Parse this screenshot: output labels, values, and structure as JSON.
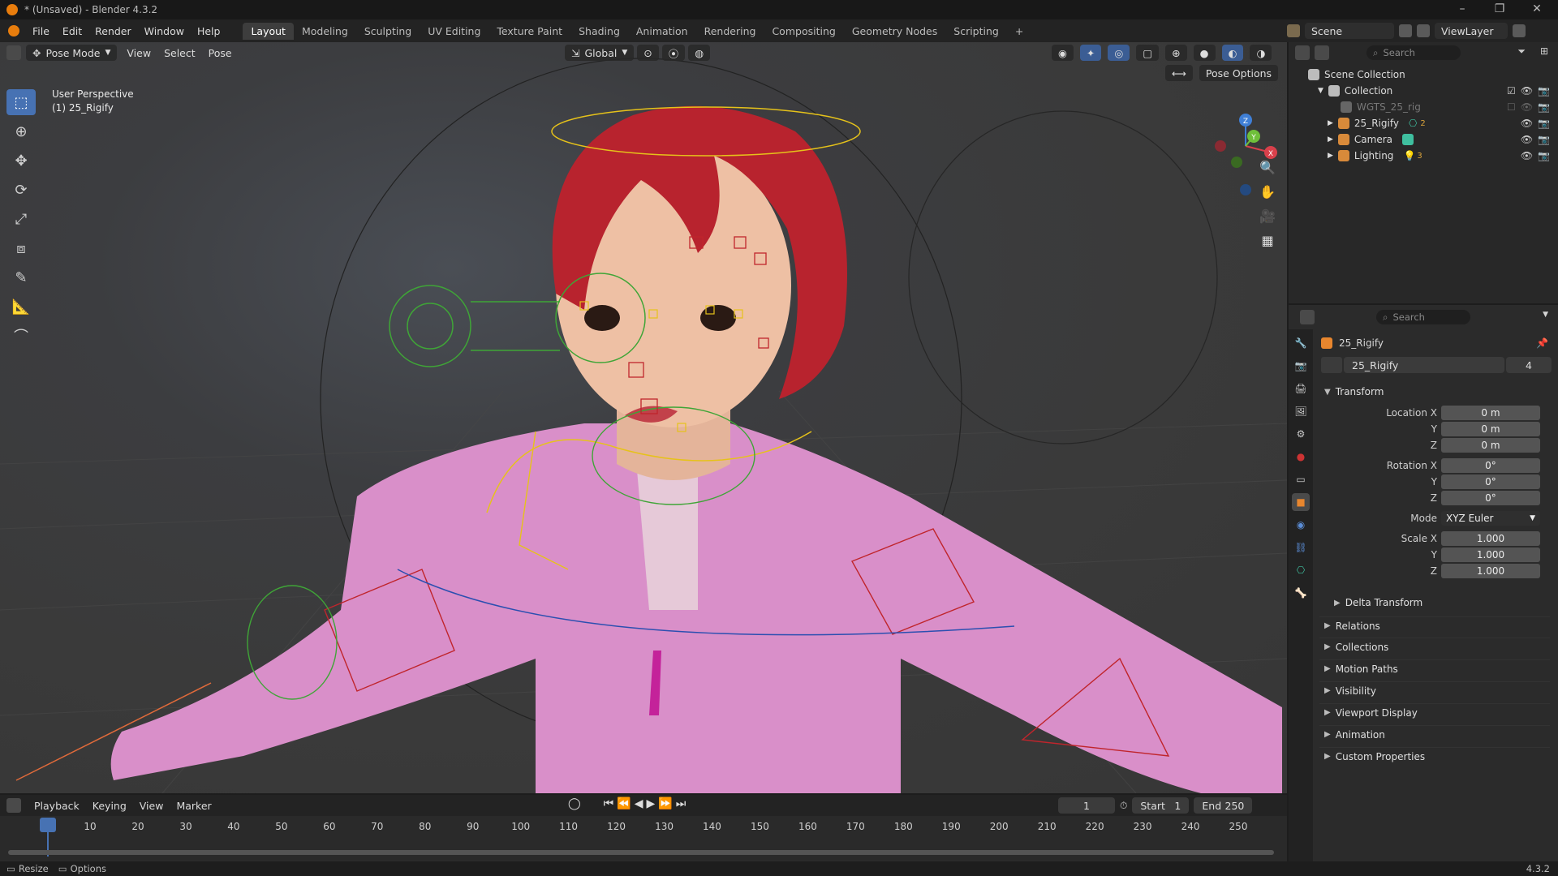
{
  "window": {
    "title": "* (Unsaved) - Blender 4.3.2"
  },
  "menu": [
    "File",
    "Edit",
    "Render",
    "Window",
    "Help"
  ],
  "workspaces": [
    "Layout",
    "Modeling",
    "Sculpting",
    "UV Editing",
    "Texture Paint",
    "Shading",
    "Animation",
    "Rendering",
    "Compositing",
    "Geometry Nodes",
    "Scripting"
  ],
  "active_workspace": "Layout",
  "scene": {
    "name": "Scene",
    "view_layer": "ViewLayer"
  },
  "viewport": {
    "mode": "Pose Mode",
    "menus": [
      "View",
      "Select",
      "Pose"
    ],
    "transform_orientation": "Global",
    "pose_options": "Pose Options",
    "info_line1": "User Perspective",
    "info_line2": "(1) 25_Rigify",
    "gizmo_axes": [
      "X",
      "Y",
      "Z"
    ]
  },
  "outliner": {
    "search_placeholder": "Search",
    "items": [
      {
        "label": "Scene Collection"
      },
      {
        "label": "Collection"
      },
      {
        "label": "WGTS_25_rig"
      },
      {
        "label": "25_Rigify",
        "extra": "2"
      },
      {
        "label": "Camera"
      },
      {
        "label": "Lighting",
        "extra": "3"
      }
    ]
  },
  "properties": {
    "search_placeholder": "Search",
    "object_name": "25_Rigify",
    "data_name": "25_Rigify",
    "users": "4",
    "transform_title": "Transform",
    "location": {
      "label": "Location X",
      "x": "0 m",
      "y": "0 m",
      "z": "0 m"
    },
    "rotation": {
      "label": "Rotation X",
      "x": "0°",
      "y": "0°",
      "z": "0°"
    },
    "mode_label": "Mode",
    "mode_value": "XYZ Euler",
    "scale": {
      "label": "Scale X",
      "x": "1.000",
      "y": "1.000",
      "z": "1.000"
    },
    "axis_y": "Y",
    "axis_z": "Z",
    "delta": "Delta Transform",
    "panels": [
      "Relations",
      "Collections",
      "Motion Paths",
      "Visibility",
      "Viewport Display",
      "Animation",
      "Custom Properties"
    ]
  },
  "timeline": {
    "menus": [
      "Playback",
      "Keying",
      "View",
      "Marker"
    ],
    "current_frame": "1",
    "start_label": "Start",
    "start": "1",
    "end_label": "End",
    "end": "250",
    "ticks": [
      "1",
      "10",
      "20",
      "30",
      "40",
      "50",
      "60",
      "70",
      "80",
      "90",
      "100",
      "110",
      "120",
      "130",
      "140",
      "150",
      "160",
      "170",
      "180",
      "190",
      "200",
      "210",
      "220",
      "230",
      "240",
      "250"
    ]
  },
  "statusbar": {
    "resize": "Resize",
    "options": "Options",
    "version": "4.3.2"
  },
  "colors": {
    "accent": "#4772b3",
    "bone_yellow": "#e6c21a",
    "bone_red": "#c0252c",
    "bone_green": "#3fa537",
    "hair": "#b8232e",
    "hoodie": "#d98fc9"
  }
}
